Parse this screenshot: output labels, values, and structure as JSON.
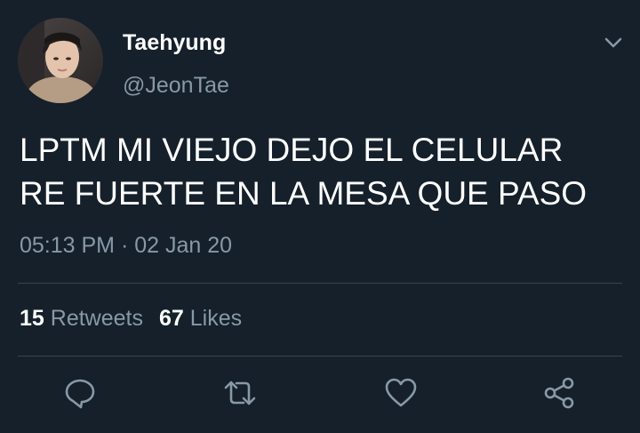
{
  "user": {
    "display_name": "Taehyung",
    "handle": "@JeonTae"
  },
  "tweet": {
    "lines": [
      "LPTM MI VIEJO DEJO EL CELULAR",
      "RE FUERTE EN LA MESA QUE PASO"
    ],
    "time": "05:13 PM",
    "separator": "·",
    "date": "02 Jan 20"
  },
  "stats": {
    "retweets_count": "15",
    "retweets_label": "Retweets",
    "likes_count": "67",
    "likes_label": "Likes"
  },
  "icons": {
    "menu": "chevron-down-icon",
    "reply": "reply-icon",
    "retweet": "retweet-icon",
    "like": "heart-icon",
    "share": "share-icon"
  },
  "colors": {
    "background": "#15202b",
    "primary_text": "#ffffff",
    "secondary_text": "#8899a6",
    "divider": "#38444d"
  }
}
